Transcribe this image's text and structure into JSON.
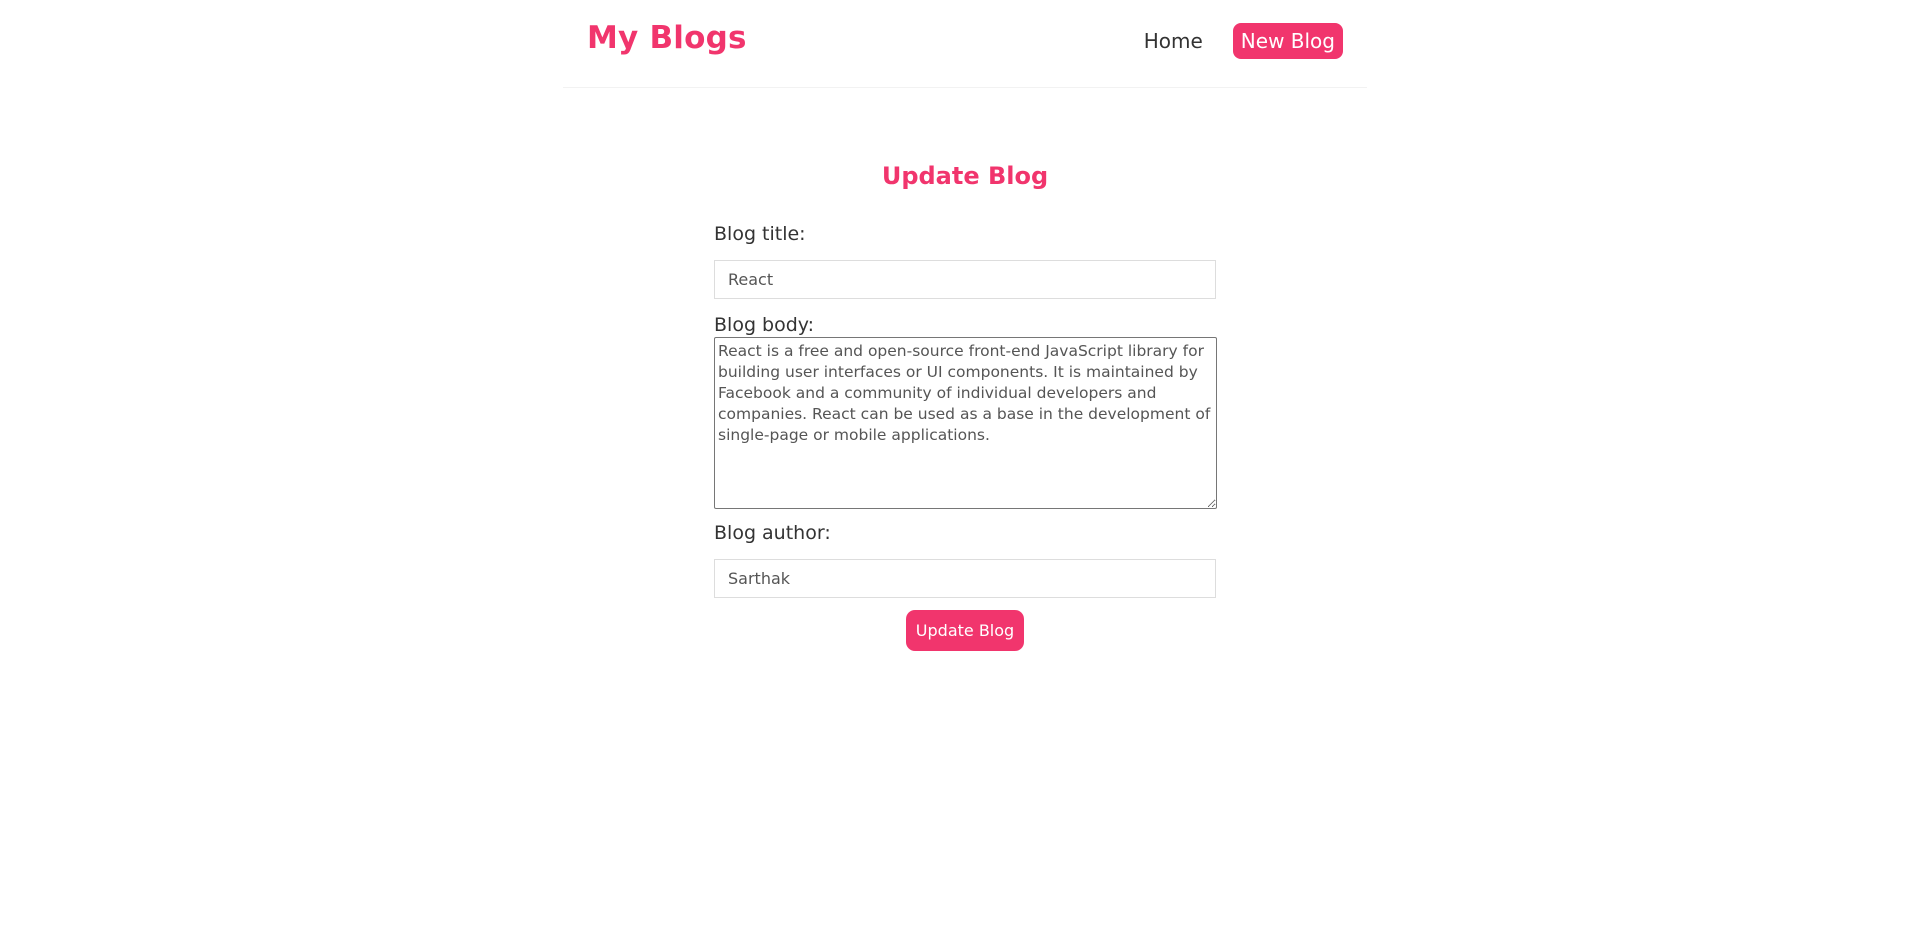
{
  "navbar": {
    "brand": "My Blogs",
    "home_label": "Home",
    "new_blog_label": "New Blog"
  },
  "form": {
    "heading": "Update Blog",
    "title_label": "Blog title:",
    "title_value": "React",
    "body_label": "Blog body:",
    "body_value": "React is a free and open-source front-end JavaScript library for building user interfaces or UI components. It is maintained by Facebook and a community of individual developers and companies. React can be used as a base in the development of single-page or mobile applications.",
    "author_label": "Blog author:",
    "author_value": "Sarthak",
    "submit_label": "Update Blog"
  },
  "colors": {
    "accent": "#f1356d",
    "text": "#333333",
    "background": "#ffffff"
  }
}
